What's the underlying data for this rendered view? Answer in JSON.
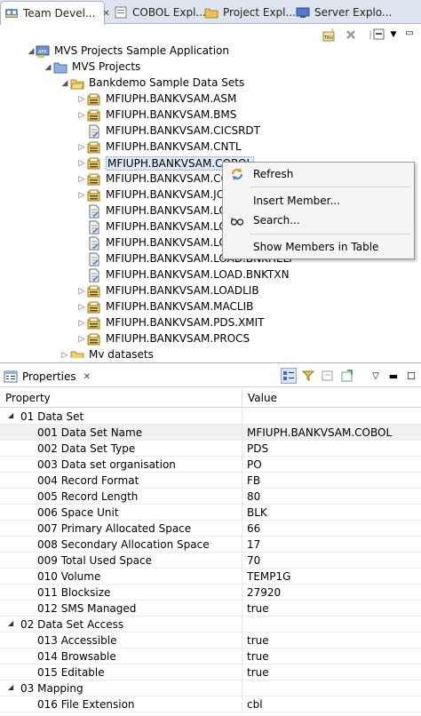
{
  "tabs": [
    {
      "label": "Team Devel...",
      "icon": "team-developer-icon",
      "active": true,
      "close": "✕"
    },
    {
      "label": "COBOL Expl...",
      "icon": "cobol-explorer-icon",
      "active": false
    },
    {
      "label": "Project Expl...",
      "icon": "project-explorer-icon",
      "active": false
    },
    {
      "label": "Server Explo...",
      "icon": "server-explorer-icon",
      "active": false
    }
  ],
  "tree": {
    "items": [
      {
        "label": "MVS Projects Sample Application",
        "icon": "application-icon",
        "expanded": true
      },
      {
        "label": "MVS Projects",
        "icon": "folder-icon",
        "expanded": true
      },
      {
        "label": "Bankdemo Sample Data Sets",
        "icon": "open-folder-icon",
        "expanded": true
      },
      {
        "label": "MFIUPH.BANKVSAM.ASM",
        "icon": "pds-icon"
      },
      {
        "label": "MFIUPH.BANKVSAM.BMS",
        "icon": "pds-icon"
      },
      {
        "label": "MFIUPH.BANKVSAM.CICSRDT",
        "icon": "sequential-file-icon"
      },
      {
        "label": "MFIUPH.BANKVSAM.CNTL",
        "icon": "pds-icon"
      },
      {
        "label": "MFIUPH.BANKVSAM.COBOL",
        "icon": "pds-icon"
      },
      {
        "label": "MFIUPH.BANKVSAM.CO",
        "icon": "pds-icon"
      },
      {
        "label": "MFIUPH.BANKVSAM.JCL",
        "icon": "pds-icon"
      },
      {
        "label": "MFIUPH.BANKVSAM.LOA",
        "icon": "sequential-file-icon"
      },
      {
        "label": "MFIUPH.BANKVSAM.LOA",
        "icon": "sequential-file-icon"
      },
      {
        "label": "MFIUPH.BANKVSAM.LOA",
        "icon": "sequential-file-icon"
      },
      {
        "label": "MFIUPH.BANKVSAM.LOAD.BNKHELP",
        "icon": "sequential-file-icon"
      },
      {
        "label": "MFIUPH.BANKVSAM.LOAD.BNKTXN",
        "icon": "sequential-file-icon"
      },
      {
        "label": "MFIUPH.BANKVSAM.LOADLIB",
        "icon": "pds-icon"
      },
      {
        "label": "MFIUPH.BANKVSAM.MACLIB",
        "icon": "pds-icon"
      },
      {
        "label": "MFIUPH.BANKVSAM.PDS.XMIT",
        "icon": "pds-icon"
      },
      {
        "label": "MFIUPH.BANKVSAM.PROCS",
        "icon": "pds-icon"
      },
      {
        "label": "My datasets",
        "icon": "folder-icon"
      }
    ]
  },
  "context_menu": {
    "items": [
      {
        "label": "Refresh",
        "icon": "refresh-icon"
      },
      {
        "label": "Insert Member...",
        "icon": ""
      },
      {
        "label": "Search...",
        "icon": "search-glasses-icon"
      },
      {
        "label": "Show Members in Table",
        "icon": ""
      }
    ]
  },
  "properties": {
    "tab_label": "Properties",
    "tab_close": "✕",
    "header_property": "Property",
    "header_value": "Value",
    "rows": [
      {
        "kind": "cat",
        "key": "01 Data Set",
        "value": ""
      },
      {
        "kind": "prop",
        "key": "001 Data Set Name",
        "value": "MFIUPH.BANKVSAM.COBOL"
      },
      {
        "kind": "prop",
        "key": "002 Data Set Type",
        "value": "PDS"
      },
      {
        "kind": "prop",
        "key": "003 Data set organisation",
        "value": "PO"
      },
      {
        "kind": "prop",
        "key": "004 Record Format",
        "value": "FB"
      },
      {
        "kind": "prop",
        "key": "005 Record Length",
        "value": "80"
      },
      {
        "kind": "prop",
        "key": "006 Space Unit",
        "value": "BLK"
      },
      {
        "kind": "prop",
        "key": "007 Primary Allocated Space",
        "value": "66"
      },
      {
        "kind": "prop",
        "key": "008 Secondary Allocation Space",
        "value": "17"
      },
      {
        "kind": "prop",
        "key": "009 Total Used Space",
        "value": "70"
      },
      {
        "kind": "prop",
        "key": "010 Volume",
        "value": "TEMP1G"
      },
      {
        "kind": "prop",
        "key": "011 Blocksize",
        "value": "27920"
      },
      {
        "kind": "prop",
        "key": "012 SMS Managed",
        "value": "true"
      },
      {
        "kind": "cat",
        "key": "02 Data Set Access",
        "value": ""
      },
      {
        "kind": "prop",
        "key": "013 Accessible",
        "value": "true"
      },
      {
        "kind": "prop",
        "key": "014 Browsable",
        "value": "true"
      },
      {
        "kind": "prop",
        "key": "015 Editable",
        "value": "true"
      },
      {
        "kind": "cat",
        "key": "03 Mapping",
        "value": ""
      },
      {
        "kind": "prop",
        "key": "016 File Extension",
        "value": "cbl"
      }
    ]
  },
  "colors": {
    "selection": "#dfe8f6",
    "tab_background": "#dde4ee",
    "pds_icon": "#d4a017"
  }
}
